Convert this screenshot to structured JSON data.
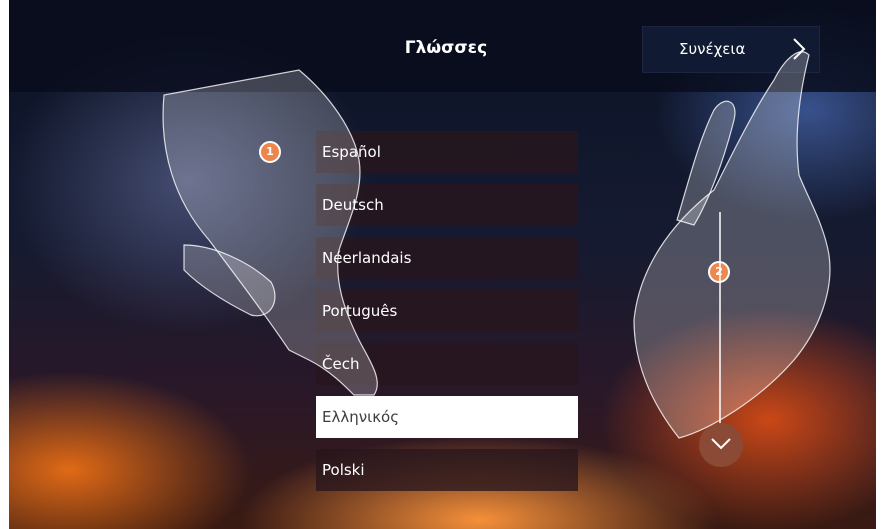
{
  "header": {
    "title": "Γλώσσες",
    "continue_label": "Συνέχεια"
  },
  "languages": {
    "items": [
      {
        "label": "Español"
      },
      {
        "label": "Deutsch"
      },
      {
        "label": "Néerlandais"
      },
      {
        "label": "Português"
      },
      {
        "label": "Čech"
      },
      {
        "label": "Ελληνικός",
        "selected": true
      },
      {
        "label": "Polski"
      }
    ]
  },
  "steps": {
    "step1": "1",
    "step2": "2"
  },
  "icons": {
    "continue": "chevron-right-icon",
    "scroll": "chevron-down-icon"
  },
  "colors": {
    "accent": "#e8641a",
    "selected_bg": "#ffffff",
    "scroll_button": "#8a4a36"
  }
}
